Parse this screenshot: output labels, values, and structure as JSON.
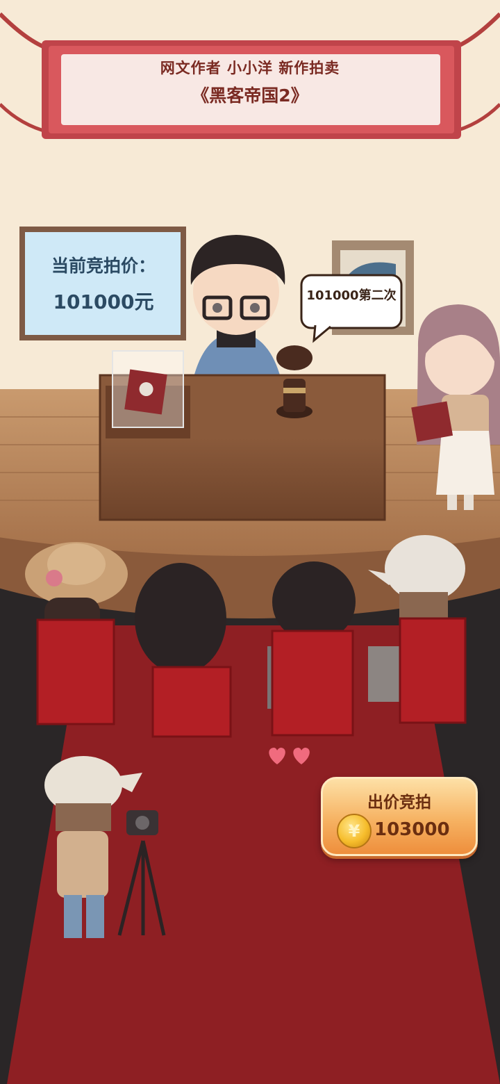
{
  "banner": {
    "line1": "网文作者  小小洋  新作拍卖",
    "line2": "《黑客帝国2》"
  },
  "price_board": {
    "label": "当前竞拍价：",
    "price": "101000元"
  },
  "auctioneer_bubble": "101000第二次",
  "bid_button": {
    "title": "出价竞拍",
    "amount": "103000",
    "coin_symbol": "¥"
  },
  "colors": {
    "wall": "#f7ead6",
    "carpet": "#8e1f23",
    "stage": "#b07e56",
    "chair": "#b31f25",
    "button": "#f6b262"
  }
}
